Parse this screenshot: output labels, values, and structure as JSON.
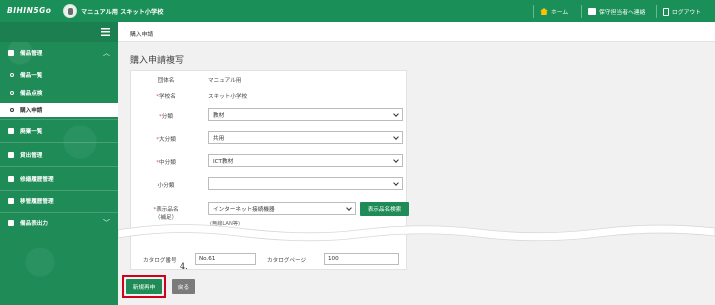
{
  "header": {
    "logo": "BIHIN5Go",
    "org_name": "マニュアル用 スキット小学校",
    "links": [
      {
        "icon": "home-icon",
        "label": "ホーム"
      },
      {
        "icon": "mail-icon",
        "label": "保守担当者へ連絡"
      },
      {
        "icon": "logout-icon",
        "label": "ログアウト"
      }
    ]
  },
  "sidebar": {
    "items": [
      {
        "label": "備品管理",
        "type": "section",
        "expanded": true
      },
      {
        "label": "備品一覧",
        "type": "sub"
      },
      {
        "label": "備品点検",
        "type": "sub"
      },
      {
        "label": "購入申請",
        "type": "sub",
        "active": true
      },
      {
        "label": "廃棄一覧",
        "type": "section"
      },
      {
        "label": "貸出管理",
        "type": "section"
      },
      {
        "label": "修繕履歴管理",
        "type": "section"
      },
      {
        "label": "移管履歴管理",
        "type": "section"
      },
      {
        "label": "備品表出力",
        "type": "section"
      }
    ]
  },
  "breadcrumb": "購入申請",
  "page_title": "購入申請複写",
  "form": {
    "group_label": "団体名",
    "group_value": "マニュアル用",
    "school_label": "学校名",
    "school_value": "スキット小学校",
    "category_label": "分類",
    "category_value": "教材",
    "major_label": "大分類",
    "major_value": "共用",
    "middle_label": "中分類",
    "middle_value": "ICT教材",
    "minor_label": "小分類",
    "minor_value": "",
    "display_label": "表示品名",
    "display_label_sub": "（補足）",
    "display_value": "インターネット接続機器",
    "display_search_btn": "表示品名検索",
    "display_hint": "(無線LAN等)",
    "catalog_no_label": "カタログ番号",
    "catalog_no_value": "No.61",
    "catalog_page_label": "カタログページ",
    "catalog_page_value": "100",
    "required_mark": "*"
  },
  "annotation": {
    "step": "4."
  },
  "buttons": {
    "submit": "新規再申",
    "back": "戻る"
  }
}
